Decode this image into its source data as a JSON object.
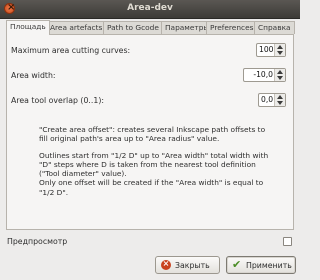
{
  "window": {
    "title": "Area-dev"
  },
  "tabs": [
    {
      "label": "Площадь",
      "active": true
    },
    {
      "label": "Area artefacts",
      "active": false
    },
    {
      "label": "Path to Gcode",
      "active": false
    },
    {
      "label": "Параметры",
      "active": false
    },
    {
      "label": "Preferences",
      "active": false
    },
    {
      "label": "Справка",
      "active": false
    }
  ],
  "fields": {
    "max_curves": {
      "label": "Maximum area cutting curves:",
      "value": "100"
    },
    "area_width": {
      "label": "Area width:",
      "value": "-10,0"
    },
    "tool_overlap": {
      "label": "Area tool overlap (0..1):",
      "value": "0,0"
    }
  },
  "description": {
    "p1": "\"Create area offset\": creates several Inkscape path offsets to fill original path's area up to \"Area radius\" value.",
    "p2": "Outlines start from \"1/2 D\" up to \"Area width\" total width with \"D\" steps where D is taken from the nearest tool definition (\"Tool diameter\" value).",
    "p3": "Only one offset will be created if the \"Area width\" is equal to \"1/2 D\"."
  },
  "preview": {
    "label": "Предпросмотр",
    "checked": false
  },
  "buttons": {
    "close": "Закрыть",
    "apply": "Применить"
  },
  "colors": {
    "titlebar": "#3d3b37",
    "apply_icon": "#4a8c24",
    "close_icon": "#c9421f"
  }
}
